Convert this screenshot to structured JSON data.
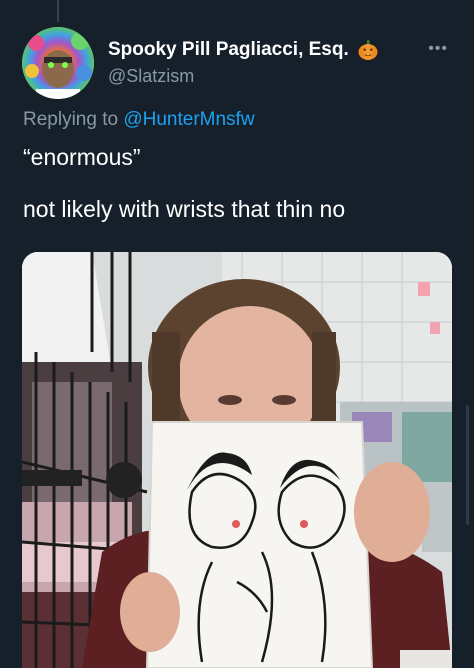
{
  "tweet": {
    "author": {
      "display_name": "Spooky Pill Pagliacci, Esq.",
      "handle": "@Slatzism",
      "badge_icon": "pumpkin-icon",
      "avatar_icon": "avatar-image"
    },
    "more_icon": "more-icon",
    "reply_prefix": "Replying to",
    "reply_mention": "@HunterMnsfw",
    "lines": [
      "“enormous”",
      "not likely with wrists that thin no"
    ],
    "media": {
      "kind": "photo",
      "description_icon": "photo-image"
    }
  },
  "colors": {
    "background": "#15202b",
    "primary_text": "#ffffff",
    "secondary_text": "#8899a6",
    "accent": "#1da1f2"
  }
}
